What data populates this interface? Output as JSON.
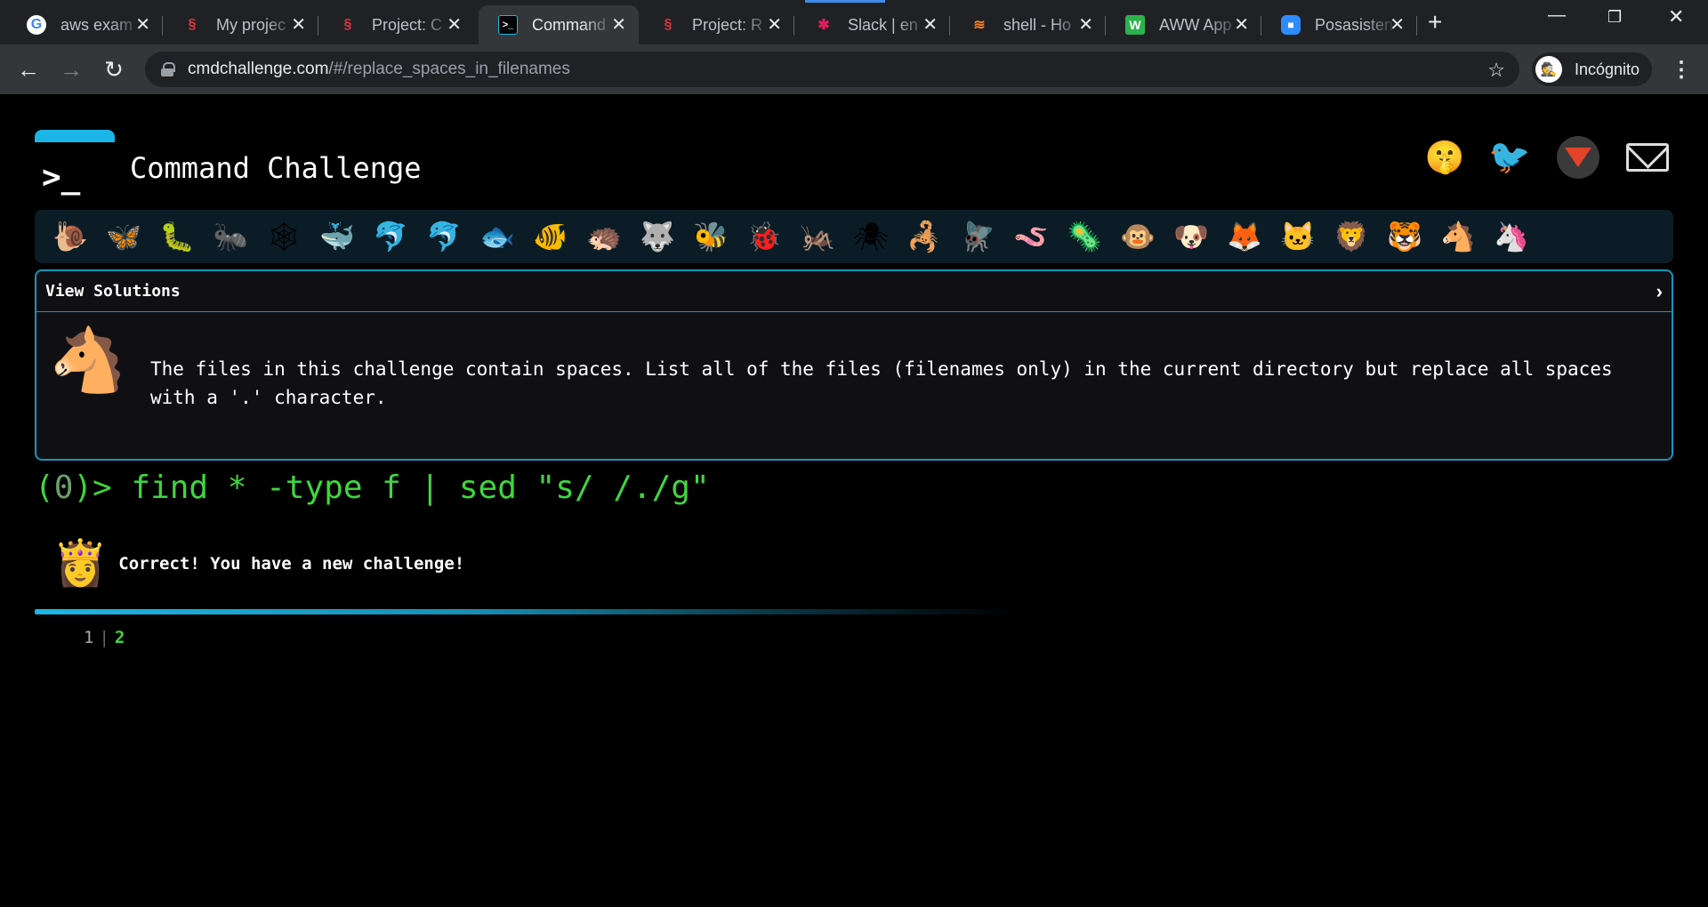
{
  "browser": {
    "tabs": [
      {
        "title": "aws exam",
        "icon": "google-icon",
        "active": false
      },
      {
        "title": "My projec",
        "icon": "seahorse-icon",
        "active": false
      },
      {
        "title": "Project: C",
        "icon": "seahorse-icon",
        "active": false
      },
      {
        "title": "Command",
        "icon": "terminal-icon",
        "active": true
      },
      {
        "title": "Project: R",
        "icon": "seahorse-icon",
        "active": false
      },
      {
        "title": "Slack | en",
        "icon": "slack-icon",
        "active": false
      },
      {
        "title": "shell - Ho",
        "icon": "stackoverflow-icon",
        "active": false
      },
      {
        "title": "AWW App",
        "icon": "aww-icon",
        "active": false
      },
      {
        "title": "Posasisten",
        "icon": "zoom-icon",
        "active": false
      }
    ],
    "url_domain": "cmdchallenge.com",
    "url_path": "/#/replace_spaces_in_filenames",
    "profile_label": "Incógnito"
  },
  "site": {
    "logo_prompt": ">_",
    "title": "Command Challenge",
    "social": [
      "shush-face-icon",
      "twitter-icon",
      "gitlab-icon",
      "mail-icon"
    ],
    "animals": [
      "🐌",
      "🦋",
      "🐛",
      "🐜",
      "🕸",
      "🐳",
      "🐬",
      "🐬",
      "🐟",
      "🐠",
      "🦔",
      "🐺",
      "🐝",
      "🐞",
      "🦗",
      "🕷",
      "🦂",
      "🪰",
      "🪱",
      "🦠",
      "🐵",
      "🐶",
      "🦊",
      "🐱",
      "🦁",
      "🐯",
      "🐴",
      "🦄"
    ]
  },
  "panel": {
    "header": "View Solutions",
    "chevron": "›",
    "challenge_icon": "🐴",
    "description": "The files in this challenge contain spaces. List all of the files (filenames only) in the current directory but replace all spaces with a '.' character."
  },
  "terminal": {
    "prefix_open": "(",
    "exit_code": "0",
    "prefix_close": ")> ",
    "command": "find * -type f | sed \"s/ /./g\""
  },
  "result": {
    "icon": "👸",
    "message": "Correct! You have a new challenge!"
  },
  "progress": {
    "fraction": 0.6
  },
  "pager": {
    "pages": [
      "1",
      "2"
    ],
    "current": "2"
  }
}
